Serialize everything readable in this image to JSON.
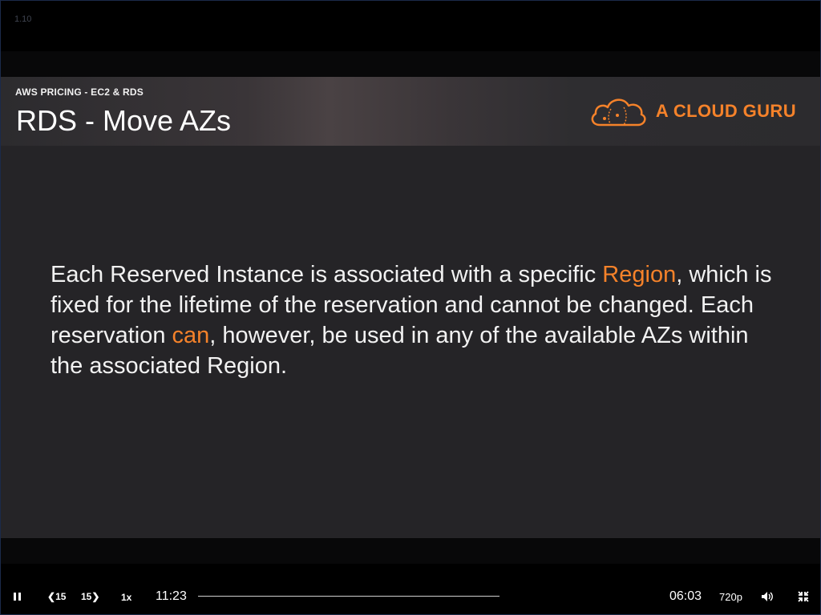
{
  "player": {
    "lesson_index": "1.10",
    "current_time": "11:23",
    "remaining_time": "06:03",
    "skip_back_label": "15",
    "skip_forward_label": "15",
    "speed_label": "1x",
    "quality_label": "720p",
    "progress_fraction": 0.65
  },
  "slide": {
    "subtitle": "AWS PRICING - EC2 & RDS",
    "title": "RDS - Move AZs",
    "logo_text": "A CLOUD GURU",
    "body": [
      {
        "text": "Each Reserved Instance is associated with a specific ",
        "highlight": false
      },
      {
        "text": "Region",
        "highlight": true
      },
      {
        "text": ", which is fixed for the lifetime of the reservation and cannot be changed. Each reservation ",
        "highlight": false
      },
      {
        "text": "can",
        "highlight": true
      },
      {
        "text": ", however, be used in any of the available AZs within the associated Region.",
        "highlight": false
      }
    ]
  },
  "colors": {
    "accent": "#f5822a",
    "slide_bg": "#252427",
    "text": "#f2f2f2"
  },
  "icons": [
    "pause-icon",
    "skip-back-icon",
    "skip-forward-icon",
    "volume-icon",
    "exit-fullscreen-icon",
    "cloud-logo-icon"
  ]
}
